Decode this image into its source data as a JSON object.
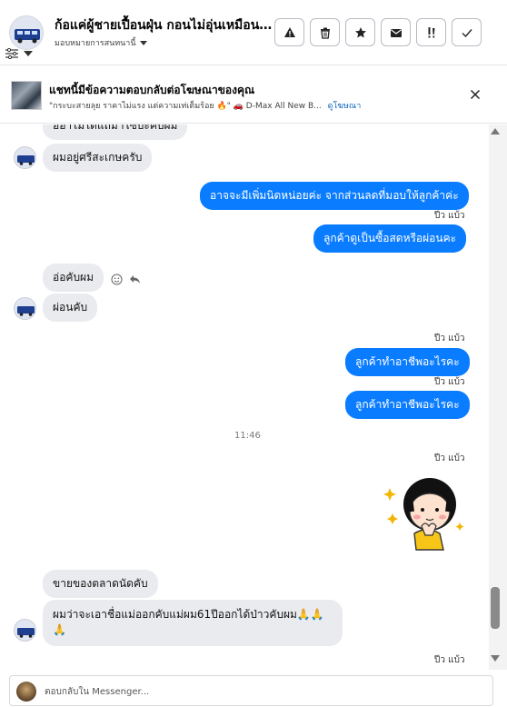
{
  "header": {
    "title": "ก้อแค่ผู้ชายเปื้อนฝุ่น กอนไม่อุ่นเหมือนคน...",
    "subtitle": "มอบหมายการสนทนานี้",
    "actions": [
      "warning-icon",
      "trash-icon",
      "star-icon",
      "mail-icon",
      "important-icon",
      "check-icon"
    ]
  },
  "ad": {
    "title": "แชทนี้มีข้อความตอบกลับต่อโฆษณาของคุณ",
    "line": "\"กระบะสายลุย ราคาไม่แรง แต่ความเท่เต็มร้อย 🔥\" 🚗 D-Max All New B...",
    "link": "ดูโฆษณา"
  },
  "messages": {
    "in_cut": "ออาไมได้แถมาไซบะคับผม",
    "in_1": "ผมอยู่ศรีสะเกษครับ",
    "out_1": "อาจจะมีเพิ่มนิดหน่อยค่ะ จากส่วนลดที่มอบให้ลูกค้าค่ะ",
    "seen_1": "ปีว แบ้ว",
    "out_2": "ลูกค้าดูเป็นซื้อสดหรือผ่อนคะ",
    "in_2": "อ่อคับผม",
    "in_3": "ผ่อนคับ",
    "seen_2": "ปีว แบ้ว",
    "out_3": "ลูกค้าทำอาชีพอะไรคะ",
    "seen_3": "ปีว แบ้ว",
    "out_4": "ลูกค้าทำอาชีพอะไรคะ",
    "time": "11:46",
    "seen_4": "ปีว แบ้ว",
    "in_4": "ขายของตลาดนัดคับ",
    "in_5": "ผมว่าจะเอาชื่อแม่ออกคับแม่ผม61ปีออกได้ป่าวคับผม🙏🙏🙏",
    "seen_5": "ปีว แบ้ว"
  },
  "composer": {
    "placeholder": "ตอบกลับใน Messenger..."
  },
  "colors": {
    "outgoing": "#0a7cff",
    "incoming": "#eaebee"
  }
}
